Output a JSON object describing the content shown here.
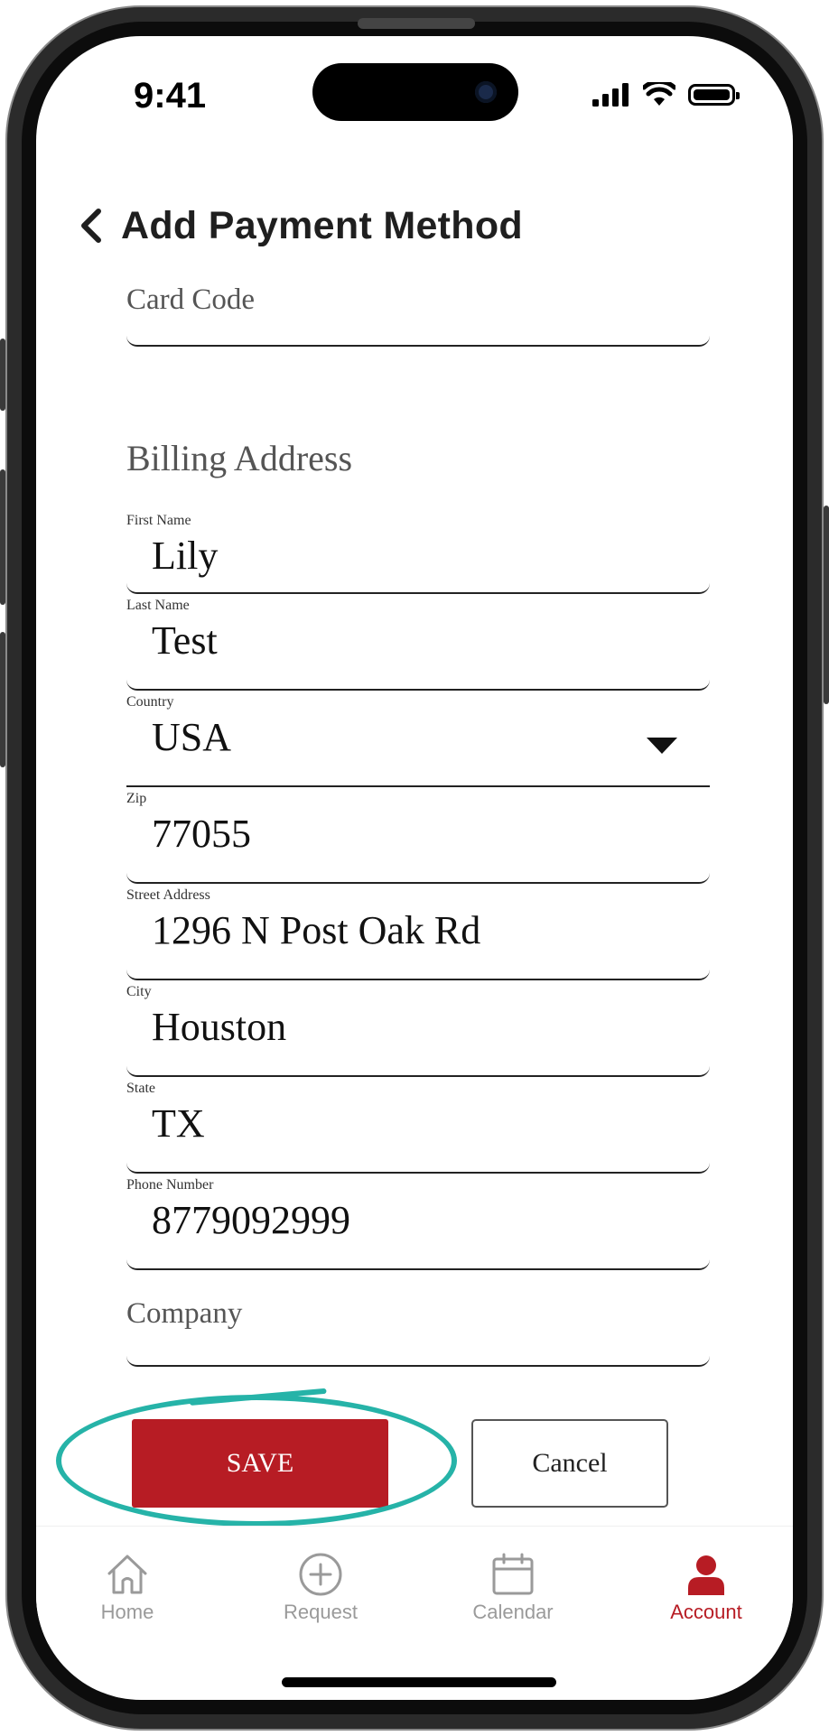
{
  "status_bar": {
    "time": "9:41"
  },
  "header": {
    "title": "Add Payment Method"
  },
  "form": {
    "card_code": {
      "placeholder": "Card Code"
    },
    "billing_section_title": "Billing Address",
    "fields": [
      {
        "label": "First Name",
        "value": "Lily"
      },
      {
        "label": "Last Name",
        "value": "Test"
      },
      {
        "label": "Country",
        "value": "USA"
      },
      {
        "label": "Zip",
        "value": "77055"
      },
      {
        "label": "Street Address",
        "value": "1296 N Post Oak Rd"
      },
      {
        "label": "City",
        "value": "Houston"
      },
      {
        "label": "State",
        "value": "TX"
      },
      {
        "label": "Phone Number",
        "value": "8779092999"
      }
    ],
    "company": {
      "placeholder": "Company"
    }
  },
  "actions": {
    "save_label": "SAVE",
    "cancel_label": "Cancel"
  },
  "tabbar": {
    "items": [
      {
        "label": "Home",
        "icon": "home-icon"
      },
      {
        "label": "Request",
        "icon": "plus-circle-icon"
      },
      {
        "label": "Calendar",
        "icon": "calendar-icon"
      },
      {
        "label": "Account",
        "icon": "account-icon",
        "active": true
      }
    ]
  },
  "colors": {
    "accent": "#b71c24",
    "highlight": "#26b3a8",
    "inactive_tab": "#9a9a9a"
  }
}
